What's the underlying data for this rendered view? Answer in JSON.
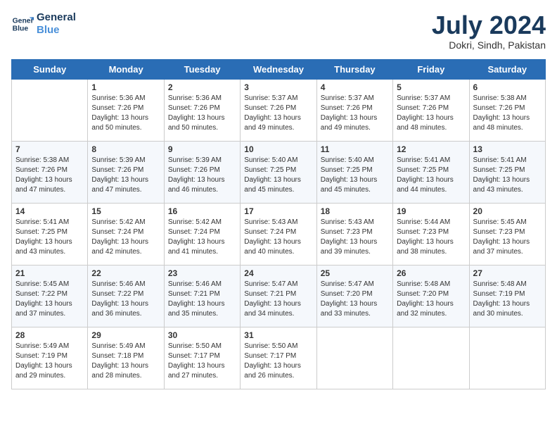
{
  "header": {
    "logo_line1": "General",
    "logo_line2": "Blue",
    "month": "July 2024",
    "location": "Dokri, Sindh, Pakistan"
  },
  "weekdays": [
    "Sunday",
    "Monday",
    "Tuesday",
    "Wednesday",
    "Thursday",
    "Friday",
    "Saturday"
  ],
  "weeks": [
    [
      {
        "day": "",
        "text": ""
      },
      {
        "day": "1",
        "text": "Sunrise: 5:36 AM\nSunset: 7:26 PM\nDaylight: 13 hours\nand 50 minutes."
      },
      {
        "day": "2",
        "text": "Sunrise: 5:36 AM\nSunset: 7:26 PM\nDaylight: 13 hours\nand 50 minutes."
      },
      {
        "day": "3",
        "text": "Sunrise: 5:37 AM\nSunset: 7:26 PM\nDaylight: 13 hours\nand 49 minutes."
      },
      {
        "day": "4",
        "text": "Sunrise: 5:37 AM\nSunset: 7:26 PM\nDaylight: 13 hours\nand 49 minutes."
      },
      {
        "day": "5",
        "text": "Sunrise: 5:37 AM\nSunset: 7:26 PM\nDaylight: 13 hours\nand 48 minutes."
      },
      {
        "day": "6",
        "text": "Sunrise: 5:38 AM\nSunset: 7:26 PM\nDaylight: 13 hours\nand 48 minutes."
      }
    ],
    [
      {
        "day": "7",
        "text": "Sunrise: 5:38 AM\nSunset: 7:26 PM\nDaylight: 13 hours\nand 47 minutes."
      },
      {
        "day": "8",
        "text": "Sunrise: 5:39 AM\nSunset: 7:26 PM\nDaylight: 13 hours\nand 47 minutes."
      },
      {
        "day": "9",
        "text": "Sunrise: 5:39 AM\nSunset: 7:26 PM\nDaylight: 13 hours\nand 46 minutes."
      },
      {
        "day": "10",
        "text": "Sunrise: 5:40 AM\nSunset: 7:25 PM\nDaylight: 13 hours\nand 45 minutes."
      },
      {
        "day": "11",
        "text": "Sunrise: 5:40 AM\nSunset: 7:25 PM\nDaylight: 13 hours\nand 45 minutes."
      },
      {
        "day": "12",
        "text": "Sunrise: 5:41 AM\nSunset: 7:25 PM\nDaylight: 13 hours\nand 44 minutes."
      },
      {
        "day": "13",
        "text": "Sunrise: 5:41 AM\nSunset: 7:25 PM\nDaylight: 13 hours\nand 43 minutes."
      }
    ],
    [
      {
        "day": "14",
        "text": "Sunrise: 5:41 AM\nSunset: 7:25 PM\nDaylight: 13 hours\nand 43 minutes."
      },
      {
        "day": "15",
        "text": "Sunrise: 5:42 AM\nSunset: 7:24 PM\nDaylight: 13 hours\nand 42 minutes."
      },
      {
        "day": "16",
        "text": "Sunrise: 5:42 AM\nSunset: 7:24 PM\nDaylight: 13 hours\nand 41 minutes."
      },
      {
        "day": "17",
        "text": "Sunrise: 5:43 AM\nSunset: 7:24 PM\nDaylight: 13 hours\nand 40 minutes."
      },
      {
        "day": "18",
        "text": "Sunrise: 5:43 AM\nSunset: 7:23 PM\nDaylight: 13 hours\nand 39 minutes."
      },
      {
        "day": "19",
        "text": "Sunrise: 5:44 AM\nSunset: 7:23 PM\nDaylight: 13 hours\nand 38 minutes."
      },
      {
        "day": "20",
        "text": "Sunrise: 5:45 AM\nSunset: 7:23 PM\nDaylight: 13 hours\nand 37 minutes."
      }
    ],
    [
      {
        "day": "21",
        "text": "Sunrise: 5:45 AM\nSunset: 7:22 PM\nDaylight: 13 hours\nand 37 minutes."
      },
      {
        "day": "22",
        "text": "Sunrise: 5:46 AM\nSunset: 7:22 PM\nDaylight: 13 hours\nand 36 minutes."
      },
      {
        "day": "23",
        "text": "Sunrise: 5:46 AM\nSunset: 7:21 PM\nDaylight: 13 hours\nand 35 minutes."
      },
      {
        "day": "24",
        "text": "Sunrise: 5:47 AM\nSunset: 7:21 PM\nDaylight: 13 hours\nand 34 minutes."
      },
      {
        "day": "25",
        "text": "Sunrise: 5:47 AM\nSunset: 7:20 PM\nDaylight: 13 hours\nand 33 minutes."
      },
      {
        "day": "26",
        "text": "Sunrise: 5:48 AM\nSunset: 7:20 PM\nDaylight: 13 hours\nand 32 minutes."
      },
      {
        "day": "27",
        "text": "Sunrise: 5:48 AM\nSunset: 7:19 PM\nDaylight: 13 hours\nand 30 minutes."
      }
    ],
    [
      {
        "day": "28",
        "text": "Sunrise: 5:49 AM\nSunset: 7:19 PM\nDaylight: 13 hours\nand 29 minutes."
      },
      {
        "day": "29",
        "text": "Sunrise: 5:49 AM\nSunset: 7:18 PM\nDaylight: 13 hours\nand 28 minutes."
      },
      {
        "day": "30",
        "text": "Sunrise: 5:50 AM\nSunset: 7:17 PM\nDaylight: 13 hours\nand 27 minutes."
      },
      {
        "day": "31",
        "text": "Sunrise: 5:50 AM\nSunset: 7:17 PM\nDaylight: 13 hours\nand 26 minutes."
      },
      {
        "day": "",
        "text": ""
      },
      {
        "day": "",
        "text": ""
      },
      {
        "day": "",
        "text": ""
      }
    ]
  ]
}
